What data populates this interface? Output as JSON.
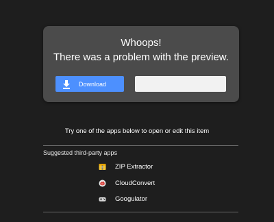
{
  "error": {
    "title_line1": "Whoops!",
    "title_line2": "There was a problem with the preview.",
    "download_label": "Download",
    "secondary_label": ""
  },
  "hint": "Try one of the apps below to open or edit this item",
  "suggested": {
    "heading": "Suggested third-party apps",
    "apps": [
      {
        "name": "ZIP Extractor",
        "icon": "zip-extractor-icon"
      },
      {
        "name": "CloudConvert",
        "icon": "cloudconvert-icon"
      },
      {
        "name": "Googulator",
        "icon": "googulator-icon"
      }
    ]
  },
  "colors": {
    "background": "#1e1e1e",
    "card": "#4b4b4b",
    "accent": "#4d90fe"
  }
}
